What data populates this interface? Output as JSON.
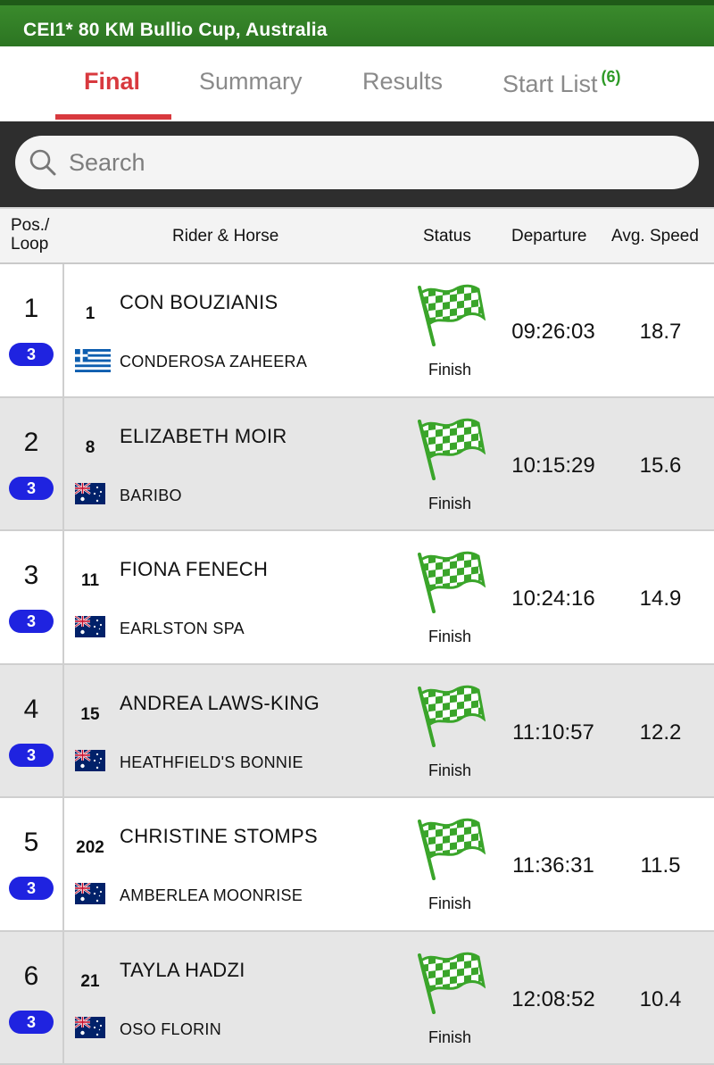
{
  "event": {
    "title": "CEI1* 80 KM Bullio Cup, Australia"
  },
  "tabs": [
    {
      "label": "Final",
      "active": true
    },
    {
      "label": "Summary",
      "active": false
    },
    {
      "label": "Results",
      "active": false
    },
    {
      "label": "Start List",
      "count": "(6)",
      "active": false
    }
  ],
  "search": {
    "placeholder": "Search",
    "value": ""
  },
  "columns": {
    "pos_line1": "Pos./",
    "pos_line2": "Loop",
    "rider_horse": "Rider & Horse",
    "status": "Status",
    "departure": "Departure",
    "speed": "Avg. Speed"
  },
  "colors": {
    "title_bar": "#2c7522",
    "active_tab": "#d8393e",
    "start_list_count": "#2e9a27",
    "loop_badge": "#1f23e0",
    "finish_flag": "#3aa52a"
  },
  "rows": [
    {
      "pos": "1",
      "loop": "3",
      "bib": "1",
      "rider": "CON BOUZIANIS",
      "horse": "CONDEROSA ZAHEERA",
      "flag_icon": "greece-flag-icon",
      "status": "Finish",
      "status_icon": "checkered-flag-icon",
      "departure": "09:26:03",
      "speed": "18.7"
    },
    {
      "pos": "2",
      "loop": "3",
      "bib": "8",
      "rider": "ELIZABETH MOIR",
      "horse": "BARIBO",
      "flag_icon": "australia-flag-icon",
      "status": "Finish",
      "status_icon": "checkered-flag-icon",
      "departure": "10:15:29",
      "speed": "15.6"
    },
    {
      "pos": "3",
      "loop": "3",
      "bib": "11",
      "rider": "FIONA FENECH",
      "horse": "EARLSTON SPA",
      "flag_icon": "australia-flag-icon",
      "status": "Finish",
      "status_icon": "checkered-flag-icon",
      "departure": "10:24:16",
      "speed": "14.9"
    },
    {
      "pos": "4",
      "loop": "3",
      "bib": "15",
      "rider": "ANDREA LAWS-KING",
      "horse": "HEATHFIELD'S BONNIE",
      "flag_icon": "australia-flag-icon",
      "status": "Finish",
      "status_icon": "checkered-flag-icon",
      "departure": "11:10:57",
      "speed": "12.2"
    },
    {
      "pos": "5",
      "loop": "3",
      "bib": "202",
      "rider": "CHRISTINE STOMPS",
      "horse": "AMBERLEA MOONRISE",
      "flag_icon": "australia-flag-icon",
      "status": "Finish",
      "status_icon": "checkered-flag-icon",
      "departure": "11:36:31",
      "speed": "11.5"
    },
    {
      "pos": "6",
      "loop": "3",
      "bib": "21",
      "rider": "TAYLA HADZI",
      "horse": "OSO FLORIN",
      "flag_icon": "australia-flag-icon",
      "status": "Finish",
      "status_icon": "checkered-flag-icon",
      "departure": "12:08:52",
      "speed": "10.4"
    }
  ]
}
